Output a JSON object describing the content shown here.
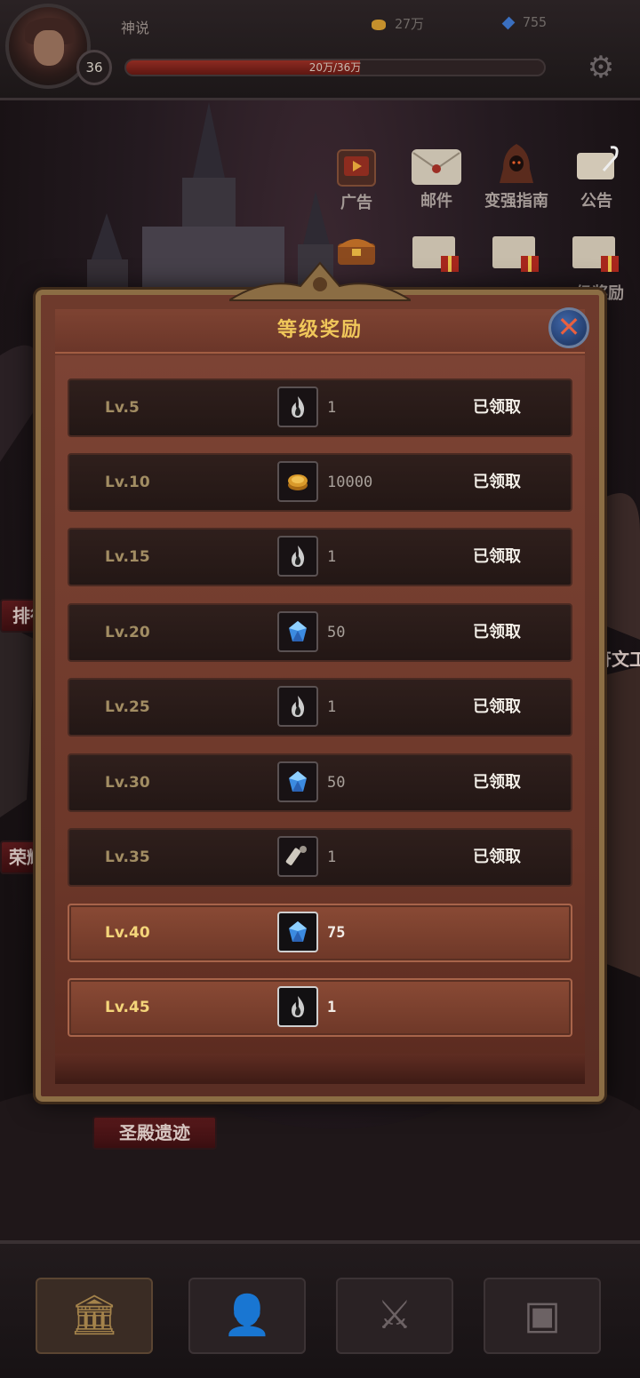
{
  "player": {
    "name": "神说",
    "level": "36",
    "xp_text": "20万/36万",
    "xp_fraction": 0.56
  },
  "resources": {
    "gold": "27万",
    "gems": "755"
  },
  "icons": {
    "settings": "gear-icon"
  },
  "menu": [
    {
      "label": "广告",
      "icon": "tv-icon"
    },
    {
      "label": "邮件",
      "icon": "envelope-icon"
    },
    {
      "label": "变强指南",
      "icon": "hooded-figure-icon"
    },
    {
      "label": "公告",
      "icon": "scroll-quill-icon"
    }
  ],
  "menu_row2": {
    "partial_label": "级奖励"
  },
  "background_labels": {
    "rank": "排行",
    "glory": "荣耀",
    "rune": "符文工",
    "temple": "圣殿遗迹"
  },
  "dialog": {
    "title": "等级奖励",
    "close_icon": "close-icon",
    "rows": [
      {
        "level": "Lv.5",
        "item": "fire-icon",
        "qty": "1",
        "status": "已领取",
        "state": "claimed"
      },
      {
        "level": "Lv.10",
        "item": "coin-icon",
        "qty": "10000",
        "status": "已领取",
        "state": "claimed"
      },
      {
        "level": "Lv.15",
        "item": "fire-icon",
        "qty": "1",
        "status": "已领取",
        "state": "claimed"
      },
      {
        "level": "Lv.20",
        "item": "gem-icon",
        "qty": "50",
        "status": "已领取",
        "state": "claimed"
      },
      {
        "level": "Lv.25",
        "item": "fire-icon",
        "qty": "1",
        "status": "已领取",
        "state": "claimed"
      },
      {
        "level": "Lv.30",
        "item": "gem-icon",
        "qty": "50",
        "status": "已领取",
        "state": "claimed"
      },
      {
        "level": "Lv.35",
        "item": "scroll-icon",
        "qty": "1",
        "status": "已领取",
        "state": "claimed"
      },
      {
        "level": "Lv.40",
        "item": "gem-icon",
        "qty": "75",
        "status": "",
        "state": "available"
      },
      {
        "level": "Lv.45",
        "item": "fire-icon",
        "qty": "1",
        "status": "",
        "state": "available"
      }
    ]
  },
  "bottom_nav": [
    {
      "icon": "temple-icon",
      "active": true
    },
    {
      "icon": "hero-bust-icon",
      "active": false
    },
    {
      "icon": "crossed-swords-icon",
      "active": false
    },
    {
      "icon": "treasure-chest-icon",
      "active": false
    }
  ],
  "colors": {
    "title_gold": "#f0c75a",
    "claimed_level": "#a28d63",
    "available_level": "#f4d57a",
    "xp_fill": "#8d2b22",
    "close_button": "#3f66a8"
  }
}
